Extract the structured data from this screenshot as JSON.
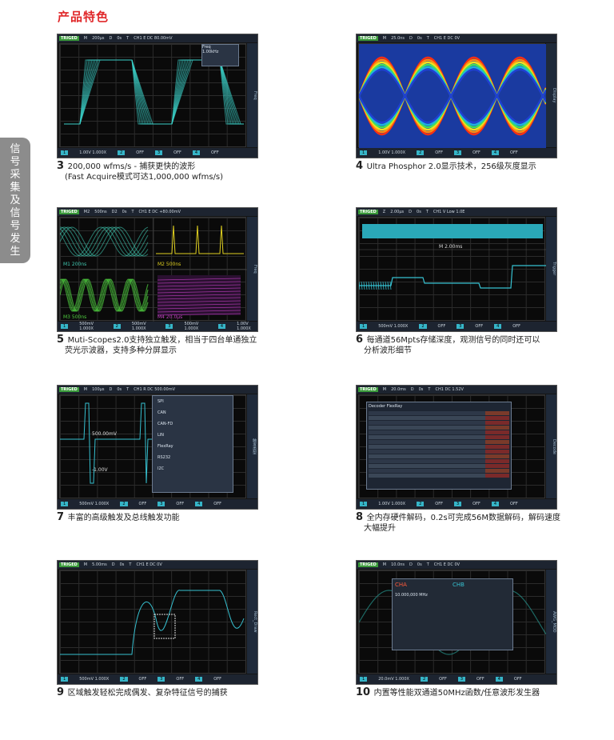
{
  "page_title": "产品特色",
  "side_tab": "信号采集及信号发生",
  "features": [
    {
      "num": "3",
      "line1": "200,000 wfms/s - 捕获更快的波形",
      "line2": "(Fast Acquire模式可达1,000,000 wfms/s)",
      "hdr": [
        "TRIGED",
        "M",
        "200μs",
        "D",
        "0s",
        "T",
        "CH1 E DC 80.00mV"
      ],
      "ftr": [
        "1",
        "1.00V 1.000X",
        "2",
        "OFF",
        "3",
        "OFF",
        "4",
        "OFF"
      ],
      "strip": "Freq"
    },
    {
      "num": "4",
      "line1": "Ultra Phosphor 2.0显示技术，256级灰度显示",
      "line2": "",
      "hdr": [
        "TRIGED",
        "M",
        "25.0ns",
        "D",
        "0s",
        "T",
        "CH1 E DC 0V"
      ],
      "ftr": [
        "1",
        "1.00V 1.000X",
        "2",
        "OFF",
        "3",
        "OFF",
        "4",
        "OFF"
      ],
      "strip": "Display"
    },
    {
      "num": "5",
      "line1": "Muti-Scopes2.0支持独立触发，相当于四台单通独立",
      "line2": "荧光示波器，支持多种分屏显示",
      "hdr": [
        "TRIGED",
        "M2",
        "500ns",
        "D2",
        "0s",
        "T",
        "CH1 E DC +80.00mV"
      ],
      "ftr": [
        "1",
        "500mV 1.000X",
        "2",
        "500mV 1.000X",
        "3",
        "500mV 1.000X",
        "4",
        "1.00V 1.000X"
      ],
      "strip": "Freq"
    },
    {
      "num": "6",
      "line1": "每通道56Mpts存储深度，观测信号的同时还可以",
      "line2": "分析波形细节",
      "hdr": [
        "TRIGED",
        "Z",
        "2.00μs",
        "D",
        "0s",
        "T",
        "CH1 V Low 1.0E"
      ],
      "ftr": [
        "1",
        "500mV 1.000X",
        "2",
        "OFF",
        "3",
        "OFF",
        "4",
        "OFF"
      ],
      "strip": "Trigger"
    },
    {
      "num": "7",
      "line1": "丰富的高级触发及总线触发功能",
      "line2": "",
      "hdr": [
        "TRIGED",
        "M",
        "100μs",
        "D",
        "0s",
        "T",
        "CH1 R DC 500.00mV"
      ],
      "ftr": [
        "1",
        "500mV 1.000X",
        "2",
        "OFF",
        "3",
        "OFF",
        "4",
        "OFF"
      ],
      "strip": "触发类型"
    },
    {
      "num": "8",
      "line1": "全内存硬件解码，0.2s可完成56M数据解码，解码速度",
      "line2": "大幅提升",
      "hdr": [
        "TRIGED",
        "M",
        "20.0ms",
        "D",
        "0s",
        "T",
        "CH1 DC 1.52V"
      ],
      "ftr": [
        "1",
        "1.00V 1.000X",
        "2",
        "OFF",
        "3",
        "OFF",
        "4",
        "OFF"
      ],
      "strip": "Decode"
    },
    {
      "num": "9",
      "line1": "区域触发轻松完成偶发、复杂特征信号的捕获",
      "line2": "",
      "hdr": [
        "TRIGED",
        "M",
        "5.00ms",
        "D",
        "0s",
        "T",
        "CH1 E DC 0V"
      ],
      "ftr": [
        "1",
        "500mV 1.000X",
        "2",
        "OFF",
        "3",
        "OFF",
        "4",
        "OFF"
      ],
      "strip": "Rect_Draw"
    },
    {
      "num": "10",
      "line1": "内置等性能双通道50MHz函数/任意波形发生器",
      "line2": "",
      "hdr": [
        "TRIGED",
        "M",
        "10.0ns",
        "D",
        "0s",
        "T",
        "CH1 E DC 0V"
      ],
      "ftr": [
        "1",
        "20.0mV 1.000X",
        "2",
        "OFF",
        "3",
        "OFF",
        "4",
        "OFF"
      ],
      "strip": "AWG_MOD"
    }
  ],
  "panel_text": {
    "freq": "Freq",
    "freq_val": "1.00kHz",
    "m_label": "M1 200ns",
    "m2_label": "M2 500ns",
    "m3_label": "M3 500ns",
    "m4_label": "M4 20.0μs",
    "marker": "M 2.00ms",
    "v500": "500.00mV",
    "vneg": "-1.00V",
    "decoder_title": "Decoder FlexRay",
    "awg_cha": "CHA",
    "awg_chb": "CHB",
    "awg_freq": "10.000,000 MHz",
    "menu": [
      "SPI",
      "CAN",
      "CAN-FD",
      "LIN",
      "FlexRay",
      "RS232",
      "I2C"
    ]
  }
}
